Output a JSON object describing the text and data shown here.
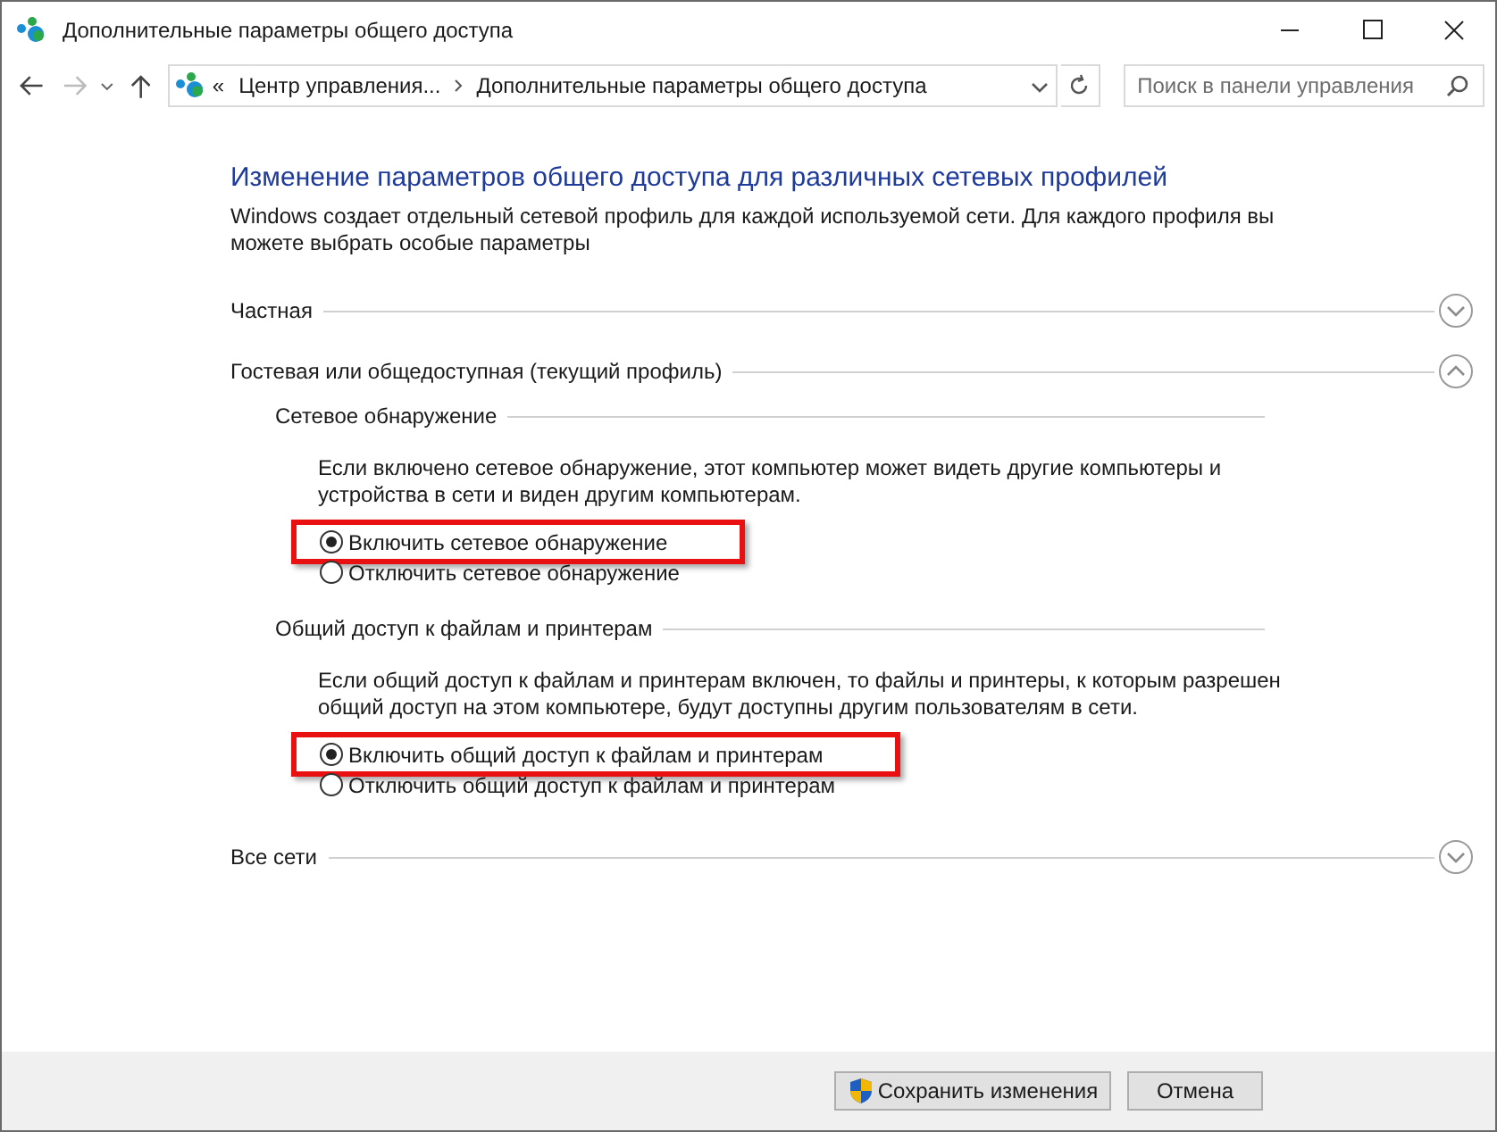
{
  "window": {
    "title": "Дополнительные параметры общего доступа"
  },
  "address_bar": {
    "overflow": "«",
    "crumbs": [
      "Центр управления...",
      "Дополнительные параметры общего доступа"
    ]
  },
  "search": {
    "placeholder": "Поиск в панели управления"
  },
  "heading": "Изменение параметров общего доступа для различных сетевых профилей",
  "intro": "Windows создает отдельный сетевой профиль для каждой используемой сети. Для каждого профиля вы можете выбрать особые параметры",
  "profiles": [
    {
      "name": "Частная",
      "expanded": false
    },
    {
      "name": "Гостевая или общедоступная (текущий профиль)",
      "expanded": true,
      "groups": [
        {
          "title": "Сетевое обнаружение",
          "description": "Если включено сетевое обнаружение, этот компьютер может видеть другие компьютеры и устройства в сети и виден другим компьютерам.",
          "options": [
            {
              "label": "Включить сетевое обнаружение",
              "selected": true,
              "highlighted": true
            },
            {
              "label": "Отключить сетевое обнаружение",
              "selected": false,
              "highlighted": false
            }
          ]
        },
        {
          "title": "Общий доступ к файлам и принтерам",
          "description": "Если общий доступ к файлам и принтерам включен, то файлы и принтеры, к которым разрешен общий доступ на этом компьютере, будут доступны другим пользователям в сети.",
          "options": [
            {
              "label": "Включить общий доступ к файлам и принтерам",
              "selected": true,
              "highlighted": true
            },
            {
              "label": "Отключить общий доступ к файлам и принтерам",
              "selected": false,
              "highlighted": false
            }
          ]
        }
      ]
    },
    {
      "name": "Все сети",
      "expanded": false
    }
  ],
  "buttons": [
    {
      "label": "Сохранить изменения",
      "kind": "shield"
    },
    {
      "label": "Отмена",
      "kind": "plain"
    }
  ]
}
